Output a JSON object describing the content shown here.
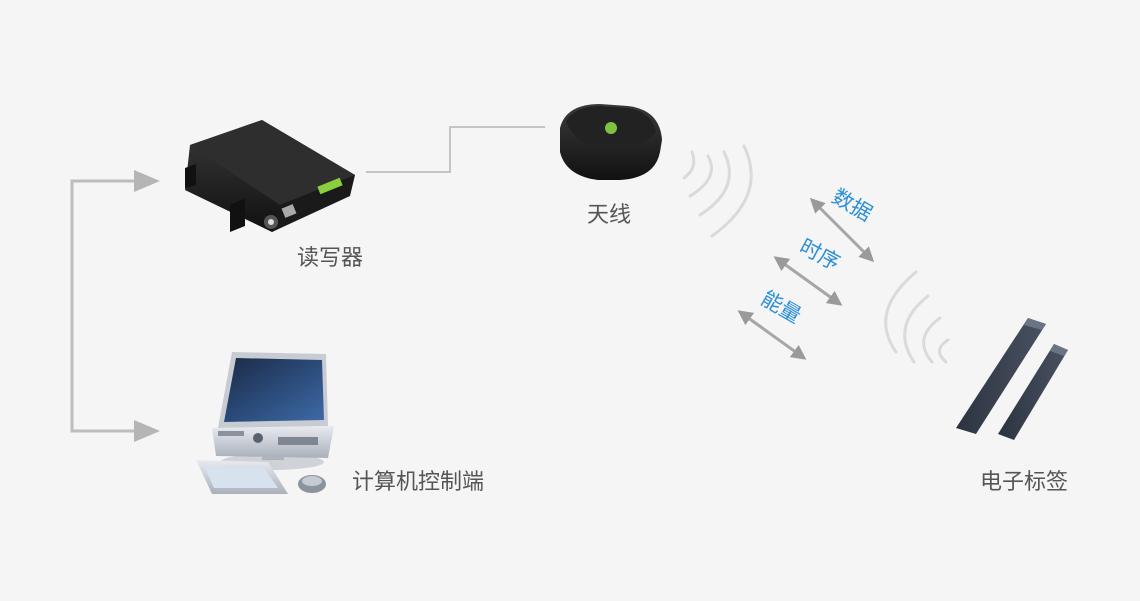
{
  "devices": {
    "reader": "读写器",
    "antenna": "天线",
    "computer": "计算机控制端",
    "tag": "电子标签"
  },
  "flows": {
    "data": "数据",
    "timing": "时序",
    "energy": "能量"
  },
  "colors": {
    "background": "#f5f5f5",
    "connector": "#bdbdbd",
    "flow_text": "#2b8fd8",
    "label_text": "#555555"
  }
}
